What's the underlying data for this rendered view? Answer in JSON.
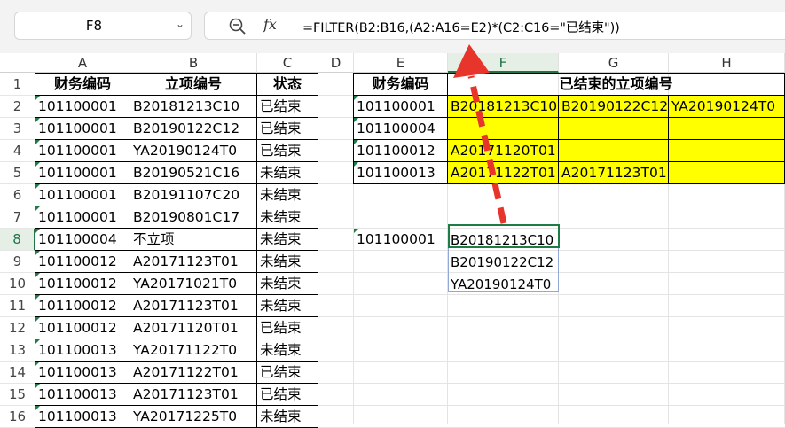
{
  "formula_bar": {
    "name_box": "F8",
    "fx_label": "fx",
    "formula": "=FILTER(B2:B16,(A2:A16=E2)*(C2:C16=\"已结束\"))"
  },
  "columns": [
    "A",
    "B",
    "C",
    "D",
    "E",
    "F",
    "G",
    "H"
  ],
  "rows": [
    "1",
    "2",
    "3",
    "4",
    "5",
    "6",
    "7",
    "8",
    "9",
    "10",
    "11",
    "12",
    "13",
    "14",
    "15",
    "16"
  ],
  "left_table": {
    "headers": [
      "财务编码",
      "立项编号",
      "状态"
    ],
    "rows": [
      [
        "101100001",
        "B20181213C10",
        "已结束"
      ],
      [
        "101100001",
        "B20190122C12",
        "已结束"
      ],
      [
        "101100001",
        "YA20190124T0",
        "已结束"
      ],
      [
        "101100001",
        "B20190521C16",
        "未结束"
      ],
      [
        "101100001",
        "B20191107C20",
        "未结束"
      ],
      [
        "101100001",
        "B20190801C17",
        "未结束"
      ],
      [
        "101100004",
        "不立项",
        "未结束"
      ],
      [
        "101100012",
        "A20171123T01",
        "未结束"
      ],
      [
        "101100012",
        "YA20171021T0",
        "未结束"
      ],
      [
        "101100012",
        "A20171123T01",
        "未结束"
      ],
      [
        "101100012",
        "A20171120T01",
        "已结束"
      ],
      [
        "101100013",
        "YA20171122T0",
        "未结束"
      ],
      [
        "101100013",
        "A20171122T01",
        "已结束"
      ],
      [
        "101100013",
        "A20171123T01",
        "已结束"
      ],
      [
        "101100013",
        "YA20171225T0",
        "未结束"
      ]
    ]
  },
  "right_table": {
    "header_code": "财务编码",
    "header_result": "已结束的立项编号",
    "rows": [
      {
        "code": "101100001",
        "f": "B20181213C10",
        "g": "B20190122C12",
        "h": "YA20190124T0"
      },
      {
        "code": "101100004",
        "f": "",
        "g": "",
        "h": ""
      },
      {
        "code": "101100012",
        "f": "A20171120T01",
        "g": "",
        "h": ""
      },
      {
        "code": "101100013",
        "f": "A20171122T01",
        "g": "A20171123T01",
        "h": ""
      }
    ]
  },
  "lookup": {
    "code": "101100001",
    "results": [
      "B20181213C10",
      "B20190122C12",
      "YA20190124T0"
    ]
  },
  "colors": {
    "highlight": "#ffff00",
    "arrow": "#e8352b",
    "selection": "#1e7c45"
  }
}
